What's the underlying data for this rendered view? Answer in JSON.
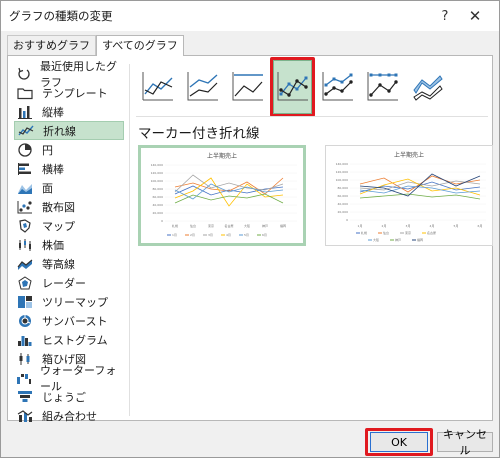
{
  "window": {
    "title": "グラフの種類の変更",
    "help_label": "?",
    "close_label": "✕"
  },
  "tabs": [
    {
      "label": "おすすめグラフ",
      "active": false
    },
    {
      "label": "すべてのグラフ",
      "active": true
    }
  ],
  "sidebar": {
    "items": [
      {
        "label": "最近使用したグラフ",
        "icon": "recent-icon"
      },
      {
        "label": "テンプレート",
        "icon": "folder-icon"
      },
      {
        "label": "縦棒",
        "icon": "column-chart-icon"
      },
      {
        "label": "折れ線",
        "icon": "line-chart-icon",
        "selected": true
      },
      {
        "label": "円",
        "icon": "pie-chart-icon"
      },
      {
        "label": "横棒",
        "icon": "bar-chart-icon"
      },
      {
        "label": "面",
        "icon": "area-chart-icon"
      },
      {
        "label": "散布図",
        "icon": "scatter-chart-icon"
      },
      {
        "label": "マップ",
        "icon": "map-chart-icon"
      },
      {
        "label": "株価",
        "icon": "stock-chart-icon"
      },
      {
        "label": "等高線",
        "icon": "surface-chart-icon"
      },
      {
        "label": "レーダー",
        "icon": "radar-chart-icon"
      },
      {
        "label": "ツリーマップ",
        "icon": "treemap-icon"
      },
      {
        "label": "サンバースト",
        "icon": "sunburst-icon"
      },
      {
        "label": "ヒストグラム",
        "icon": "histogram-icon"
      },
      {
        "label": "箱ひげ図",
        "icon": "box-whisker-icon"
      },
      {
        "label": "ウォーターフォール",
        "icon": "waterfall-icon"
      },
      {
        "label": "じょうご",
        "icon": "funnel-icon"
      },
      {
        "label": "組み合わせ",
        "icon": "combo-chart-icon"
      }
    ]
  },
  "subtypes": [
    {
      "icon": "line-subtype-icon",
      "selected": false
    },
    {
      "icon": "stacked-line-subtype-icon",
      "selected": false
    },
    {
      "icon": "100-stacked-line-subtype-icon",
      "selected": false
    },
    {
      "icon": "line-with-markers-subtype-icon",
      "selected": true
    },
    {
      "icon": "stacked-line-markers-subtype-icon",
      "selected": false
    },
    {
      "icon": "100-stacked-line-markers-subtype-icon",
      "selected": false
    },
    {
      "icon": "3d-line-subtype-icon",
      "selected": false
    }
  ],
  "section_title": "マーカー付き折れ線",
  "previews": [
    {
      "title": "上半期売上",
      "y_ticks": [
        "140,000",
        "120,000",
        "100,000",
        "80,000",
        "60,000",
        "40,000",
        "20,000",
        "0"
      ],
      "x_labels": [
        "札幌",
        "仙台",
        "東京",
        "名古屋",
        "大阪",
        "神戸",
        "福岡"
      ],
      "legend": [
        "1月",
        "2月",
        "3月",
        "4月",
        "5月",
        "6月"
      ]
    },
    {
      "title": "上半期売上",
      "y_ticks": [
        "140,000",
        "120,000",
        "100,000",
        "80,000",
        "60,000",
        "40,000",
        "20,000",
        "0"
      ],
      "x_labels": [
        "1月",
        "2月",
        "3月",
        "4月",
        "5月",
        "6月"
      ],
      "legend": [
        "札幌",
        "仙台",
        "東京",
        "名古屋",
        "大阪",
        "神戸",
        "福岡"
      ]
    }
  ],
  "buttons": {
    "ok": "OK",
    "cancel": "キャンセル"
  },
  "colors": {
    "accent_green": "#c6e2cd",
    "highlight_red": "#e0191f",
    "series": [
      "#4472c4",
      "#ed7d31",
      "#a5a5a5",
      "#ffc000",
      "#5b9bd5",
      "#70ad47",
      "#264478"
    ]
  }
}
